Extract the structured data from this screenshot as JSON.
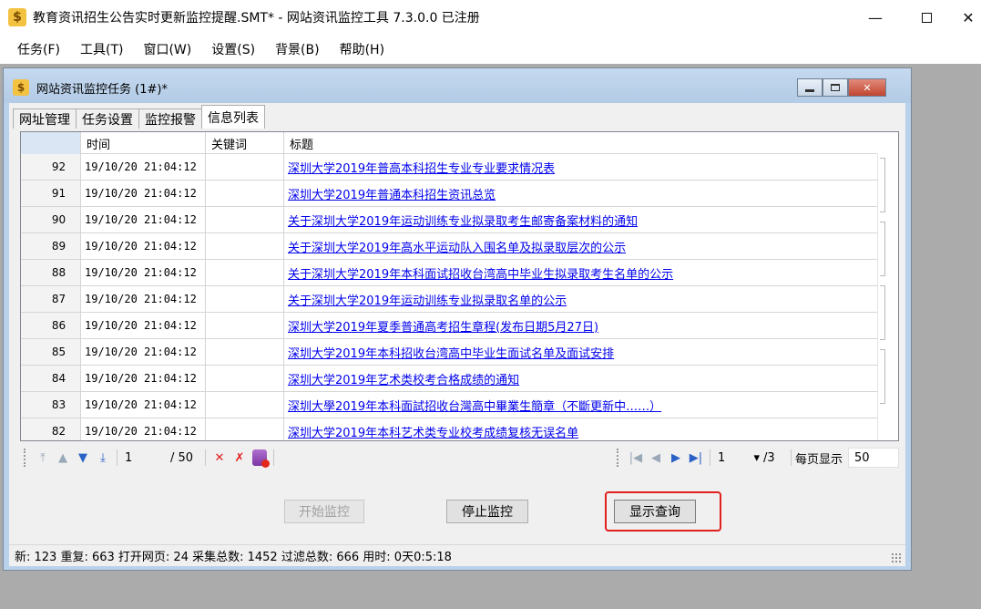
{
  "window": {
    "title": "教育资讯招生公告实时更新监控提醒.SMT* - 网站资讯监控工具 7.3.0.0  已注册",
    "app_icon": "dollar-icon"
  },
  "menubar": [
    "任务(F)",
    "工具(T)",
    "窗口(W)",
    "设置(S)",
    "背景(B)",
    "帮助(H)"
  ],
  "child_window": {
    "title": "网站资讯监控任务  (1#)*"
  },
  "tabs": [
    "网址管理",
    "任务设置",
    "监控报警",
    "信息列表"
  ],
  "active_tab": "信息列表",
  "table": {
    "headers": {
      "idx": "",
      "time": "时间",
      "keyword": "关键词",
      "title": "标题"
    },
    "rows": [
      {
        "idx": "92",
        "time": "19/10/20 21:04:12",
        "keyword": "",
        "title": "深圳大学2019年普高本科招生专业专业要求情况表"
      },
      {
        "idx": "91",
        "time": "19/10/20 21:04:12",
        "keyword": "",
        "title": "深圳大学2019年普通本科招生资讯总览"
      },
      {
        "idx": "90",
        "time": "19/10/20 21:04:12",
        "keyword": "",
        "title": "关于深圳大学2019年运动训练专业拟录取考生邮寄备案材料的通知"
      },
      {
        "idx": "89",
        "time": "19/10/20 21:04:12",
        "keyword": "",
        "title": "关于深圳大学2019年高水平运动队入围名单及拟录取层次的公示"
      },
      {
        "idx": "88",
        "time": "19/10/20 21:04:12",
        "keyword": "",
        "title": "关于深圳大学2019年本科面试招收台湾高中毕业生拟录取考生名单的公示"
      },
      {
        "idx": "87",
        "time": "19/10/20 21:04:12",
        "keyword": "",
        "title": "关于深圳大学2019年运动训练专业拟录取名单的公示"
      },
      {
        "idx": "86",
        "time": "19/10/20 21:04:12",
        "keyword": "",
        "title": "深圳大学2019年夏季普通高考招生章程(发布日期5月27日)"
      },
      {
        "idx": "85",
        "time": "19/10/20 21:04:12",
        "keyword": "",
        "title": "深圳大学2019年本科招收台湾高中毕业生面试名单及面试安排"
      },
      {
        "idx": "84",
        "time": "19/10/20 21:04:12",
        "keyword": "",
        "title": "深圳大学2019年艺术类校考合格成绩的通知"
      },
      {
        "idx": "83",
        "time": "19/10/20 21:04:12",
        "keyword": "",
        "title": "深圳大學2019年本科面試招收台灣高中畢業生簡章（不斷更新中……）"
      },
      {
        "idx": "82",
        "time": "19/10/20 21:04:12",
        "keyword": "",
        "title": "深圳大学2019年本科艺术类专业校考成绩复核无误名单"
      }
    ]
  },
  "pager": {
    "current_record": "1",
    "total_records": "/ 50",
    "current_page": "1",
    "total_pages": "/3",
    "per_page_label": "每页显示",
    "per_page_value": "50"
  },
  "buttons": {
    "start": "开始监控",
    "stop": "停止监控",
    "query": "显示查询"
  },
  "status": {
    "text": "新: 123  重复: 663  打开网页: 24  采集总数: 1452  过滤总数: 666  用时: 0天0:5:18"
  },
  "colors": {
    "link": "#0000ee",
    "highlight": "#e0201c",
    "index_header": "#dbe6f4"
  }
}
